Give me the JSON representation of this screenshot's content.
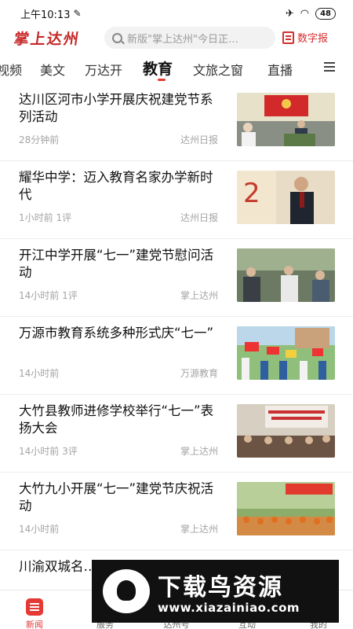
{
  "status": {
    "time": "上午10:13",
    "battery": "48"
  },
  "header": {
    "logo": "掌上达州",
    "search_placeholder": "新版\"掌上达州\"今日正…",
    "paper_label": "数字报"
  },
  "tabs": [
    "视频",
    "美文",
    "万达开",
    "教育",
    "文旅之窗",
    "直播"
  ],
  "active_tab": "教育",
  "news": [
    {
      "title": "达川区河市小学开展庆祝建党节系列活动",
      "time": "28分钟前",
      "comments": "",
      "source": "达州日报"
    },
    {
      "title": "耀华中学：迈入教育名家办学新时代",
      "time": "1小时前",
      "comments": "1评",
      "source": "达州日报"
    },
    {
      "title": "开江中学开展“七一”建党节慰问活动",
      "time": "14小时前",
      "comments": "1评",
      "source": "掌上达州"
    },
    {
      "title": "万源市教育系统多种形式庆“七一”",
      "time": "14小时前",
      "comments": "",
      "source": "万源教育"
    },
    {
      "title": "大竹县教师进修学校举行“七一”表扬大会",
      "time": "14小时前",
      "comments": "3评",
      "source": "掌上达州"
    },
    {
      "title": "大竹九小开展“七一”建党节庆祝活动",
      "time": "14小时前",
      "comments": "",
      "source": "掌上达州"
    },
    {
      "title": "川渝双城名…云端问道",
      "time": "",
      "comments": "",
      "source": ""
    }
  ],
  "bottom_nav": [
    {
      "label": "新闻",
      "active": true
    },
    {
      "label": "服务",
      "active": false
    },
    {
      "label": "达州号",
      "active": false
    },
    {
      "label": "互动",
      "active": false
    },
    {
      "label": "我的",
      "active": false
    }
  ],
  "watermark": {
    "title": "下载鸟资源",
    "url": "www.xiazainiao.com"
  },
  "colors": {
    "accent": "#e53935",
    "logo": "#c62828"
  }
}
